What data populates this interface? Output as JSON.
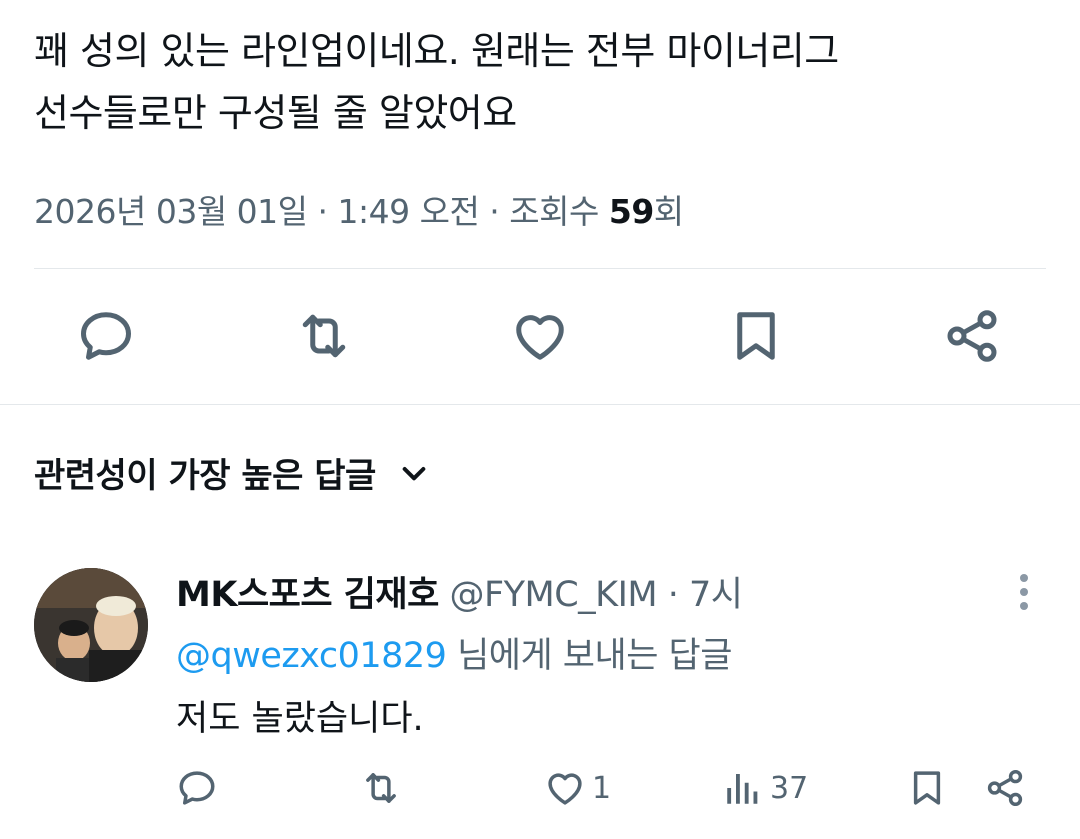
{
  "tweet": {
    "text_line1": "꽤 성의 있는 라인업이네요. 원래는 전부 마이너리그",
    "text_line2": "선수들로만 구성될 줄 알았어요",
    "meta_date": "2026년 03월 01일 · 1:49 오전 · 조회수 ",
    "meta_views": "59",
    "meta_views_suffix": "회"
  },
  "actions": {
    "icons": [
      "reply-icon",
      "retweet-icon",
      "like-icon",
      "bookmark-icon",
      "share-icon"
    ]
  },
  "relevance": {
    "label": "관련성이 가장 높은 답글"
  },
  "reply": {
    "name": "MK스포츠 김재호",
    "handle": "@FYMC_KIM",
    "dot": " · ",
    "time": "7시",
    "mention": "@qwezxc01829",
    "reply_to_suffix": " 님에게 보내는 답글",
    "body": "저도 놀랐습니다.",
    "likes": "1",
    "views": "37"
  },
  "colors": {
    "text": "#0f1419",
    "secondary": "#536471",
    "accent": "#1d9bf0",
    "divider": "#e4e8eb"
  }
}
